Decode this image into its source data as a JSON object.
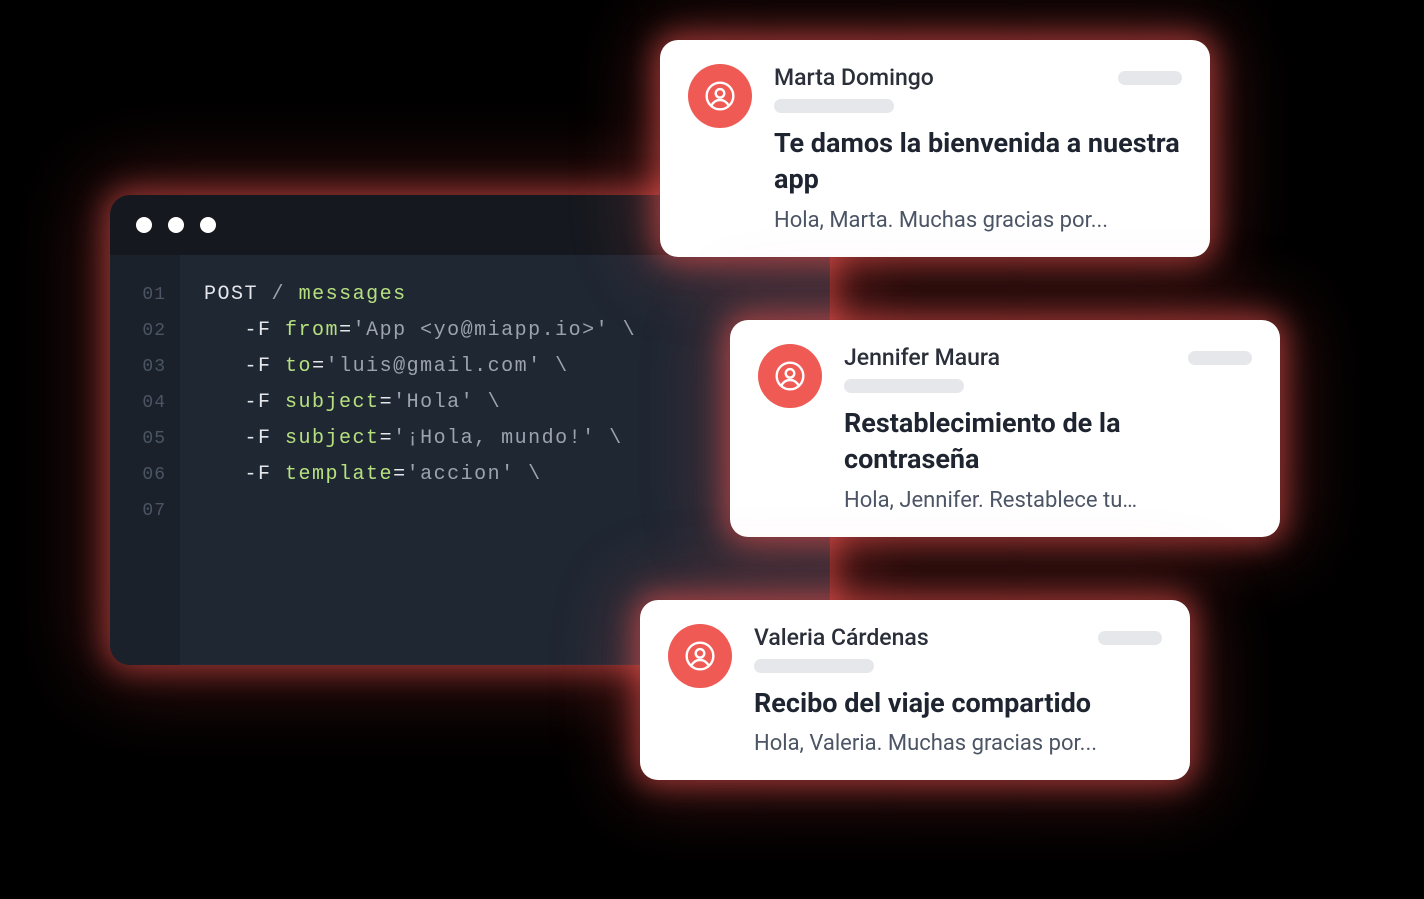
{
  "colors": {
    "accent": "#ef5a55",
    "terminal_bg": "#1f2733",
    "terminal_bar": "#15191f",
    "gutter_bg": "#1a212b"
  },
  "terminal": {
    "line_numbers": [
      "01",
      "02",
      "03",
      "04",
      "05",
      "06",
      "07"
    ],
    "request": {
      "method": "POST",
      "path": "/",
      "resource": "messages"
    },
    "flags": [
      {
        "key": "from",
        "value": "'App <yo@miapp.io>'"
      },
      {
        "key": "to",
        "value": "'luis@gmail.com'"
      },
      {
        "key": "subject",
        "value": "'Hola'"
      },
      {
        "key": "subject",
        "value": "'¡Hola, mundo!'"
      },
      {
        "key": "template",
        "value": "'accion'"
      }
    ],
    "flag_prefix": "-F",
    "continuation": "\\"
  },
  "emails": [
    {
      "sender": "Marta Domingo",
      "subject": "Te damos la bienvenida a nuestra app",
      "preview": "Hola, Marta. Muchas gracias por..."
    },
    {
      "sender": "Jennifer Maura",
      "subject": "Restablecimiento de la contraseña",
      "preview": "Hola, Jennifer. Restablece tu…"
    },
    {
      "sender": "Valeria Cárdenas",
      "subject": "Recibo del viaje compartido",
      "preview": "Hola, Valeria. Muchas gracias por..."
    }
  ]
}
